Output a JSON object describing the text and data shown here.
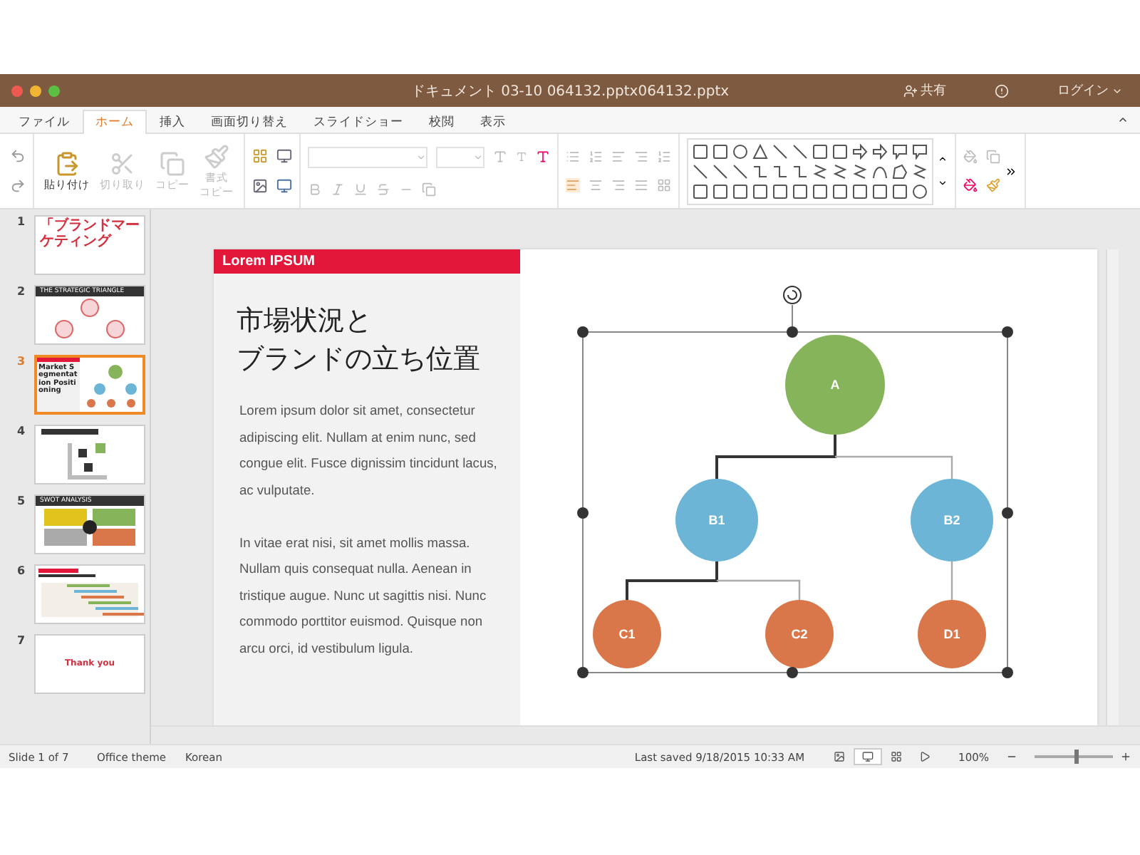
{
  "window": {
    "title": "ドキュメント 03-10 064132.pptx064132.pptx",
    "share": "共有",
    "login": "ログイン"
  },
  "tabs": [
    {
      "label": "ファイル",
      "selected": false
    },
    {
      "label": "ホーム",
      "selected": true
    },
    {
      "label": "挿入",
      "selected": false
    },
    {
      "label": "画面切り替え",
      "selected": false
    },
    {
      "label": "スライドショー",
      "selected": false
    },
    {
      "label": "校閲",
      "selected": false
    },
    {
      "label": "表示",
      "selected": false
    }
  ],
  "ribbon": {
    "clipboard": [
      {
        "lines": [
          "貼り付け"
        ],
        "disabled": false
      },
      {
        "lines": [
          "切り取り"
        ],
        "disabled": true
      },
      {
        "lines": [
          "コピー"
        ],
        "disabled": true
      },
      {
        "lines": [
          "書式",
          "コピー"
        ],
        "disabled": true
      }
    ]
  },
  "slides": [
    {
      "number": "1",
      "selected": false,
      "kind": "title",
      "text": "「ブランドマーケティング"
    },
    {
      "number": "2",
      "selected": false,
      "kind": "triangle",
      "text": "THE STRATEGIC TRIANGLE"
    },
    {
      "number": "3",
      "selected": true,
      "kind": "tree",
      "text": "Market Segmentation Positioning"
    },
    {
      "number": "4",
      "selected": false,
      "kind": "matrix"
    },
    {
      "number": "5",
      "selected": false,
      "kind": "swot",
      "text": "SWOT ANALYSIS"
    },
    {
      "number": "6",
      "selected": false,
      "kind": "gantt"
    },
    {
      "number": "7",
      "selected": false,
      "kind": "end",
      "text": "Thank you"
    }
  ],
  "slide": {
    "header": "Lorem IPSUM",
    "title_lines": [
      "市場状況と",
      "ブランドの立ち位置"
    ],
    "paragraphs": [
      "Lorem ipsum dolor sit amet, consectetur adipiscing elit. Nullam at enim nunc, sed congue elit. Fusce dignissim tincidunt lacus, ac vulputate.",
      "In vitae erat nisi, sit amet mollis massa. Nullam quis consequat nulla. Aenean in tristique augue. Nunc ut sagittis nisi. Nunc commodo porttitor euismod. Quisque non arcu orci, id vestibulum ligula."
    ],
    "nodes": [
      {
        "label": "A",
        "color": "#86b45a"
      },
      {
        "label": "B1",
        "color": "#6cb5d6"
      },
      {
        "label": "B2",
        "color": "#6cb5d6"
      },
      {
        "label": "C1",
        "color": "#d9774a"
      },
      {
        "label": "C2",
        "color": "#d9774a"
      },
      {
        "label": "D1",
        "color": "#d9774a"
      }
    ],
    "edges": [
      {
        "selected": true
      },
      {
        "selected": false
      },
      {
        "selected": true
      },
      {
        "selected": false
      },
      {
        "selected": false
      }
    ]
  },
  "status_bar": {
    "slide": "Slide 1 of 7",
    "theme": "Office theme",
    "language": "Korean",
    "saved": "Last saved 9/18/2015 10:33 AM",
    "views": [
      {
        "selected": false
      },
      {
        "selected": true
      },
      {
        "selected": false
      },
      {
        "selected": false
      }
    ],
    "zoom": "100%",
    "zoom_level": {
      "level": 0.5
    }
  }
}
